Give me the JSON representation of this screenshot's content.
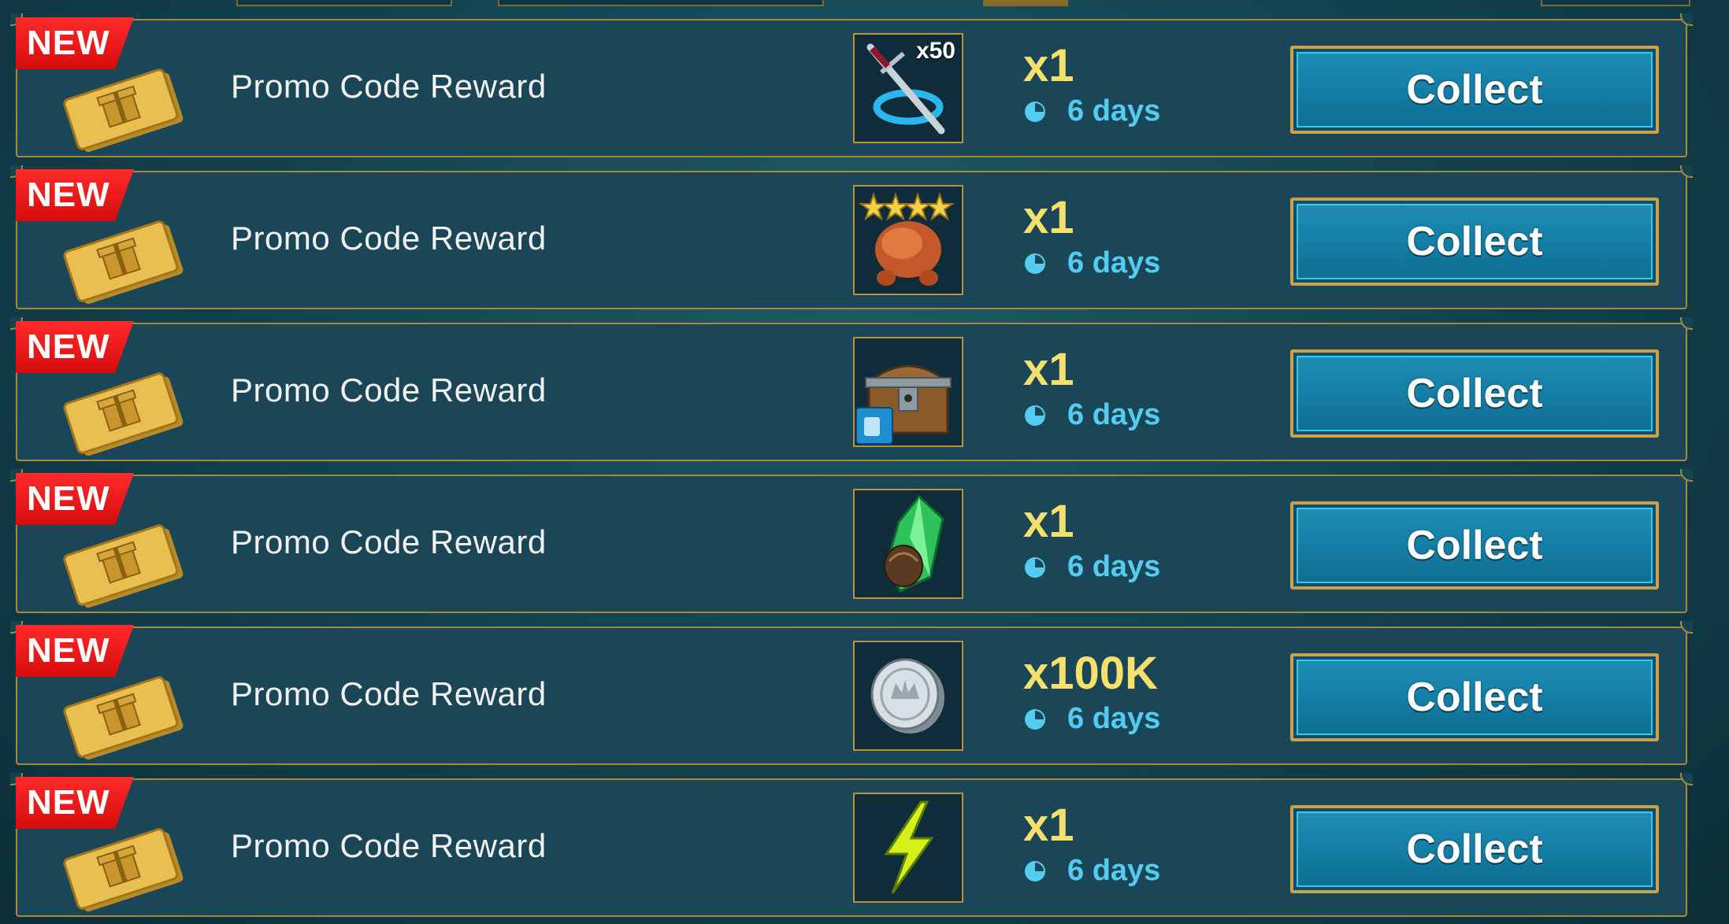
{
  "rows": [
    {
      "badge": "NEW",
      "title": "Promo Code Reward",
      "item_icon": "dagger-multiplier-icon",
      "item_overlay": "x50",
      "quantity": "x1",
      "time_left": "6 days",
      "button": "Collect"
    },
    {
      "badge": "NEW",
      "title": "Promo Code Reward",
      "item_icon": "roast-chicken-4star-icon",
      "item_overlay": "",
      "quantity": "x1",
      "time_left": "6 days",
      "button": "Collect"
    },
    {
      "badge": "NEW",
      "title": "Promo Code Reward",
      "item_icon": "treasure-chest-icon",
      "item_overlay": "",
      "quantity": "x1",
      "time_left": "6 days",
      "button": "Collect"
    },
    {
      "badge": "NEW",
      "title": "Promo Code Reward",
      "item_icon": "green-crystal-icon",
      "item_overlay": "",
      "quantity": "x1",
      "time_left": "6 days",
      "button": "Collect"
    },
    {
      "badge": "NEW",
      "title": "Promo Code Reward",
      "item_icon": "silver-coin-icon",
      "item_overlay": "",
      "quantity": "x100K",
      "time_left": "6 days",
      "button": "Collect"
    },
    {
      "badge": "NEW",
      "title": "Promo Code Reward",
      "item_icon": "energy-bolt-icon",
      "item_overlay": "",
      "quantity": "x1",
      "time_left": "6 days",
      "button": "Collect"
    }
  ],
  "colors": {
    "row_bg": "#1a4658",
    "row_border": "#a7893c",
    "badge_red": "#e51414",
    "quantity_yellow": "#f6e06c",
    "timer_cyan": "#52cdf0",
    "button_blue": "#157ea5",
    "button_border": "#caa24a"
  }
}
